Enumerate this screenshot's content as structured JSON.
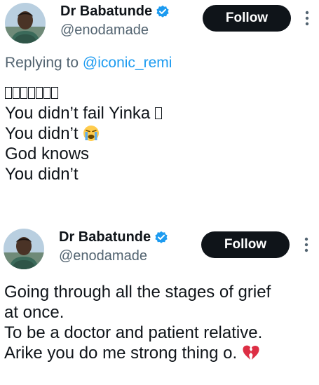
{
  "tweets": [
    {
      "author_name": "Dr Babatunde",
      "handle": "@enodamade",
      "follow_label": "Follow",
      "reply_prefix": "Replying to",
      "reply_mention": "@iconic_remi",
      "lines": [
        {
          "text": "",
          "tofu_count": 7
        },
        {
          "text": "You didn’t fail Yinka ",
          "tofu_count": 1
        },
        {
          "text": "You didn’t ",
          "emoji": "crying-face-emoji"
        },
        {
          "text": "God knows"
        },
        {
          "text": "You didn’t"
        }
      ]
    },
    {
      "author_name": "Dr Babatunde",
      "handle": "@enodamade",
      "follow_label": "Follow",
      "lines": [
        {
          "text": "Going through all the stages of grief"
        },
        {
          "text": "at once."
        },
        {
          "text": "To be a doctor and patient relative."
        },
        {
          "text": "Arike you do me strong thing o. ",
          "emoji": "broken-heart-emoji"
        }
      ]
    }
  ],
  "colors": {
    "text": "#0f1419",
    "secondary": "#536471",
    "link": "#1d9bf0",
    "verified": "#1d9bf0",
    "button_bg": "#0f1419",
    "button_text": "#ffffff"
  },
  "icons": [
    "avatar",
    "verified-badge-icon",
    "more-options-icon",
    "crying-face-emoji",
    "broken-heart-emoji"
  ]
}
